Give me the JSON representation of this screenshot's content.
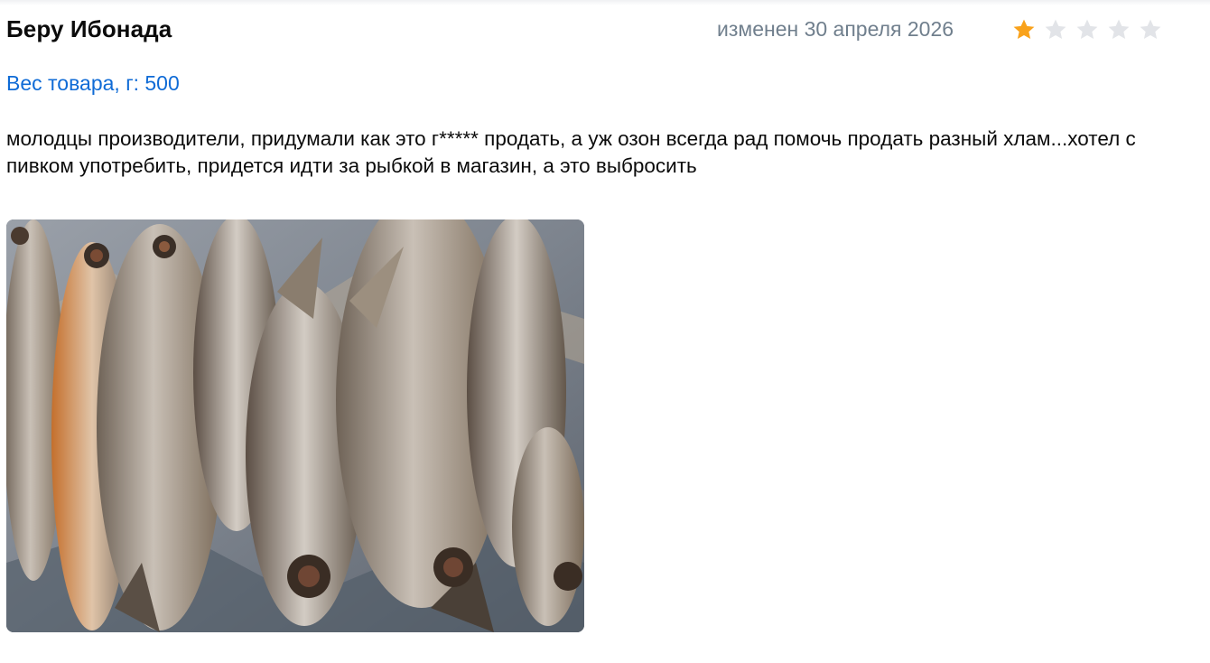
{
  "review": {
    "author": "Беру Ибонада",
    "date": "изменен 30 апреля 2026",
    "rating": 1,
    "rating_max": 5,
    "attribute": "Вес товара, г: 500",
    "text": "молодцы производители, придумали как это г***** продать, а уж озон всегда рад помочь продать разный хлам...хотел с пивком употребить, придется идти за рыбкой в магазин, а это выбросить"
  },
  "colors": {
    "star_active": "#f9a21b",
    "star_inactive": "#e2e4e8",
    "attribute_link": "#0f6bd6",
    "date_text": "#707f8d"
  },
  "icons": {
    "star": "star-icon"
  }
}
